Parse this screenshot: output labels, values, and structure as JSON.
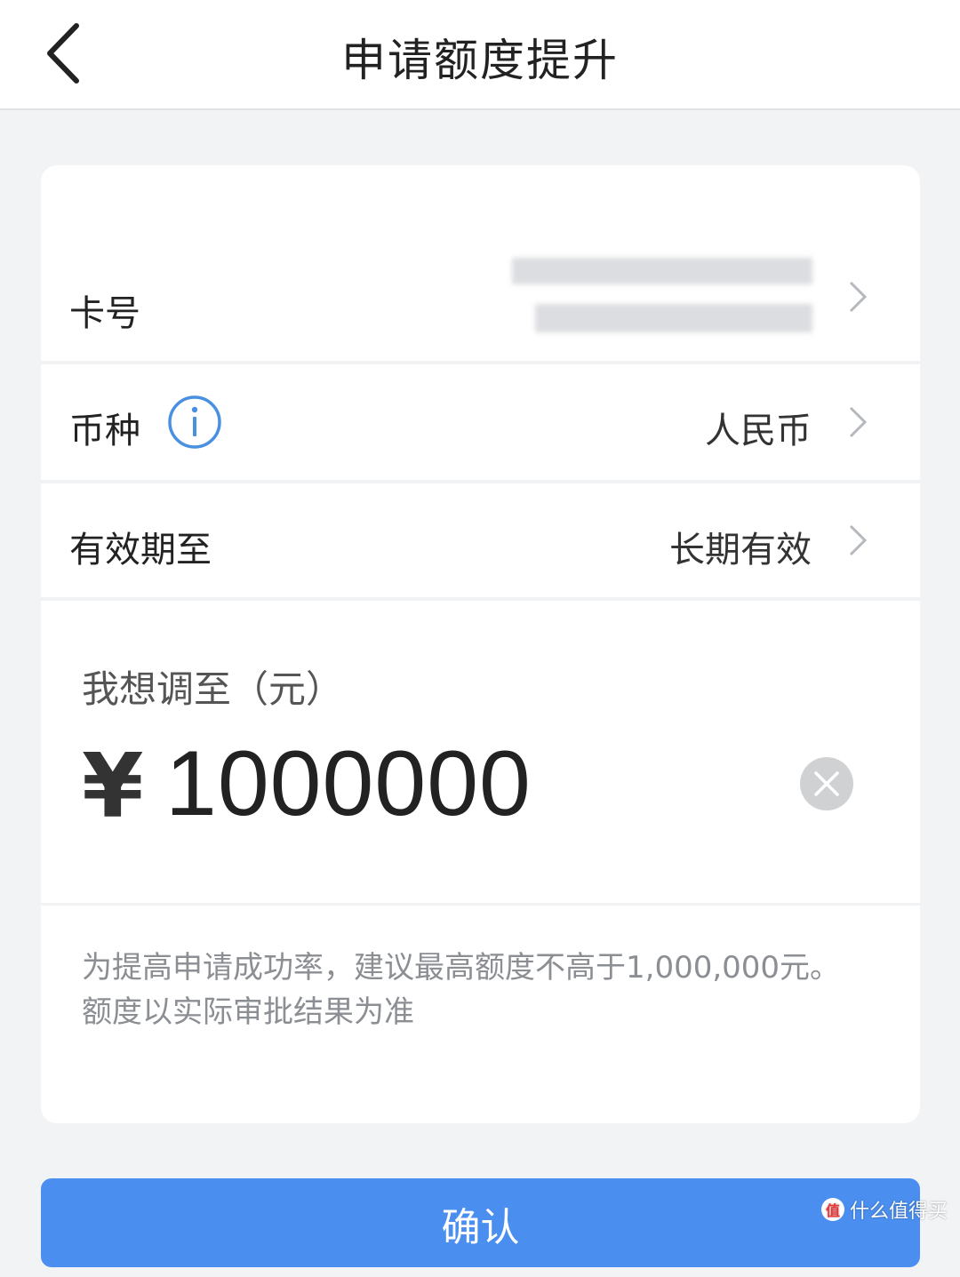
{
  "header": {
    "title": "申请额度提升"
  },
  "rows": {
    "card_number": {
      "label": "卡号"
    },
    "currency": {
      "label": "币种",
      "value": "人民币"
    },
    "validity": {
      "label": "有效期至",
      "value": "长期有效"
    }
  },
  "amount": {
    "label": "我想调至（元）",
    "symbol": "¥",
    "value": "1000000"
  },
  "hint": {
    "line1": "为提高申请成功率，建议最高额度不高于1,000,000元。",
    "line2": "额度以实际审批结果为准"
  },
  "confirm": {
    "label": "确认"
  },
  "watermark": {
    "badge": "值",
    "text": "什么值得买"
  },
  "colors": {
    "accent": "#4a8ff0",
    "info_icon": "#4a90e2"
  },
  "icons": [
    "back-arrow-icon",
    "info-icon",
    "chevron-right-icon",
    "clear-icon"
  ]
}
